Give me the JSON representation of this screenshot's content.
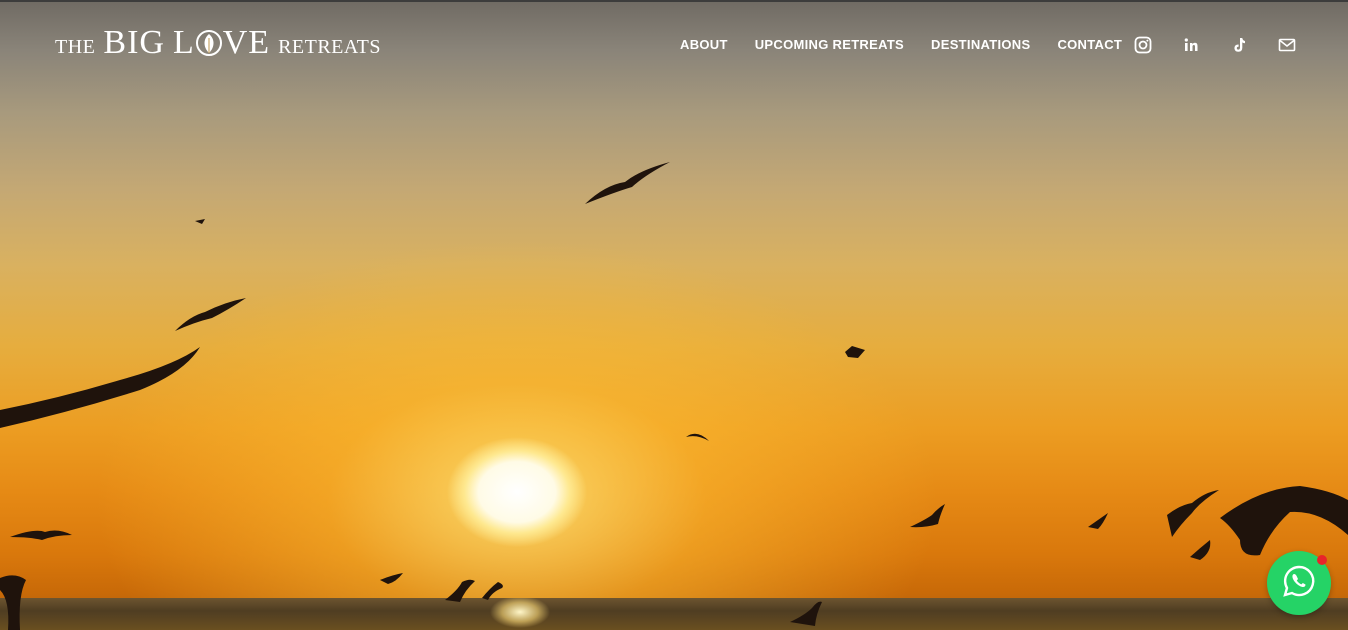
{
  "header": {
    "logo": {
      "part1": "THE",
      "part2": "BIG",
      "part3": "L",
      "part4": "VE",
      "part5": "RETREATS"
    },
    "nav": [
      {
        "label": "ABOUT"
      },
      {
        "label": "UPCOMING RETREATS"
      },
      {
        "label": "DESTINATIONS"
      },
      {
        "label": "CONTACT"
      }
    ],
    "social": [
      "instagram-icon",
      "linkedin-icon",
      "tiktok-icon",
      "mail-icon"
    ]
  },
  "chat_widget": {
    "icon": "whatsapp-icon",
    "notification": true,
    "color": "#25d366"
  },
  "hero": {
    "scene": "sunset-sea-with-birds"
  }
}
